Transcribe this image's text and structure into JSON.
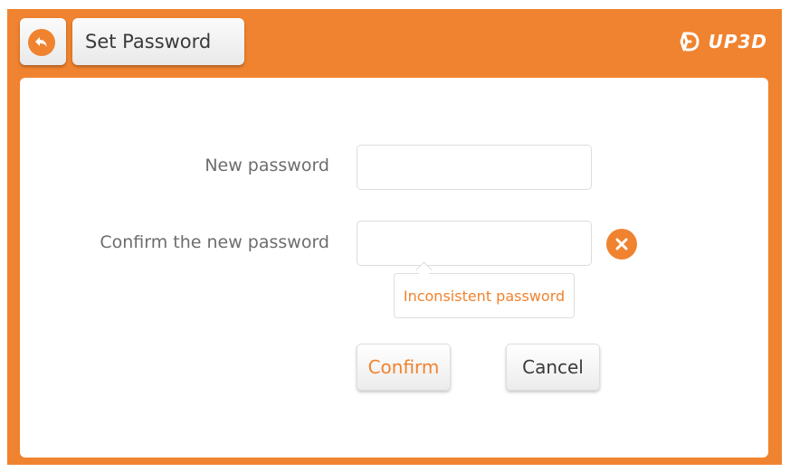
{
  "header": {
    "back_icon": "back-arrow-icon",
    "title": "Set Password",
    "logo_text": "UP3D"
  },
  "form": {
    "new_password_label": "New password",
    "new_password_value": "",
    "confirm_password_label": "Confirm the new password",
    "confirm_password_value": "",
    "error_icon": "error-x-icon",
    "error_message": "Inconsistent password"
  },
  "actions": {
    "confirm_label": "Confirm",
    "cancel_label": "Cancel"
  },
  "colors": {
    "accent": "#f0832f",
    "panel": "#ffffff",
    "text": "#3a3a3a",
    "label": "#6d6d6d"
  }
}
